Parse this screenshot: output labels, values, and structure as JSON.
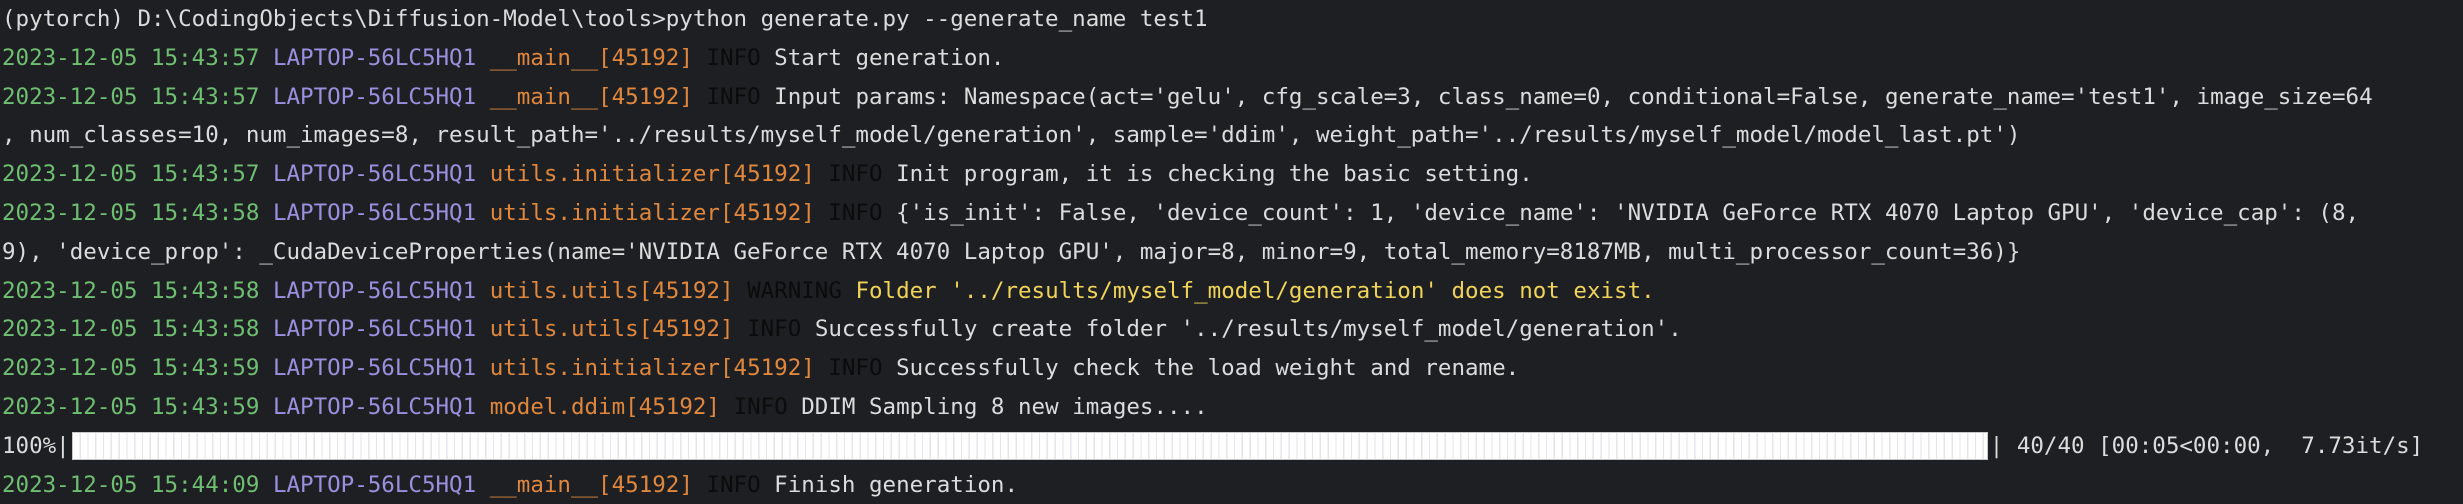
{
  "prompt_line": "(pytorch) D:\\CodingObjects\\Diffusion-Model\\tools>python generate.py --generate_name test1",
  "logs": [
    {
      "ts": "2023-12-05 15:43:57",
      "host": "LAPTOP-56LC5HQ1",
      "mod": "__main__[45192]",
      "lvl": "INFO",
      "msg": "Start generation."
    },
    {
      "ts": "2023-12-05 15:43:57",
      "host": "LAPTOP-56LC5HQ1",
      "mod": "__main__[45192]",
      "lvl": "INFO",
      "msg": "Input params: Namespace(act='gelu', cfg_scale=3, class_name=0, conditional=False, generate_name='test1', image_size=64",
      "cont": ", num_classes=10, num_images=8, result_path='../results/myself_model/generation', sample='ddim', weight_path='../results/myself_model/model_last.pt')"
    },
    {
      "ts": "2023-12-05 15:43:57",
      "host": "LAPTOP-56LC5HQ1",
      "mod": "utils.initializer[45192]",
      "lvl": "INFO",
      "msg": "Init program, it is checking the basic setting."
    },
    {
      "ts": "2023-12-05 15:43:58",
      "host": "LAPTOP-56LC5HQ1",
      "mod": "utils.initializer[45192]",
      "lvl": "INFO",
      "msg": "{'is_init': False, 'device_count': 1, 'device_name': 'NVIDIA GeForce RTX 4070 Laptop GPU', 'device_cap': (8,",
      "cont": "9), 'device_prop': _CudaDeviceProperties(name='NVIDIA GeForce RTX 4070 Laptop GPU', major=8, minor=9, total_memory=8187MB, multi_processor_count=36)}"
    },
    {
      "ts": "2023-12-05 15:43:58",
      "host": "LAPTOP-56LC5HQ1",
      "mod": "utils.utils[45192]",
      "lvl": "WARNING",
      "msg": "Folder '../results/myself_model/generation' does not exist."
    },
    {
      "ts": "2023-12-05 15:43:58",
      "host": "LAPTOP-56LC5HQ1",
      "mod": "utils.utils[45192]",
      "lvl": "INFO",
      "msg": "Successfully create folder '../results/myself_model/generation'."
    },
    {
      "ts": "2023-12-05 15:43:59",
      "host": "LAPTOP-56LC5HQ1",
      "mod": "utils.initializer[45192]",
      "lvl": "INFO",
      "msg": "Successfully check the load weight and rename."
    },
    {
      "ts": "2023-12-05 15:43:59",
      "host": "LAPTOP-56LC5HQ1",
      "mod": "model.ddim[45192]",
      "lvl": "INFO",
      "msg": "DDIM Sampling 8 new images...."
    }
  ],
  "progress": {
    "percent_label": "100%|",
    "percent_value": 1.0,
    "tail": "| 40/40 [00:05<00:00,  7.73it/s]"
  },
  "final_log": {
    "ts": "2023-12-05 15:44:09",
    "host": "LAPTOP-56LC5HQ1",
    "mod": "__main__[45192]",
    "lvl": "INFO",
    "msg": "Finish generation."
  }
}
